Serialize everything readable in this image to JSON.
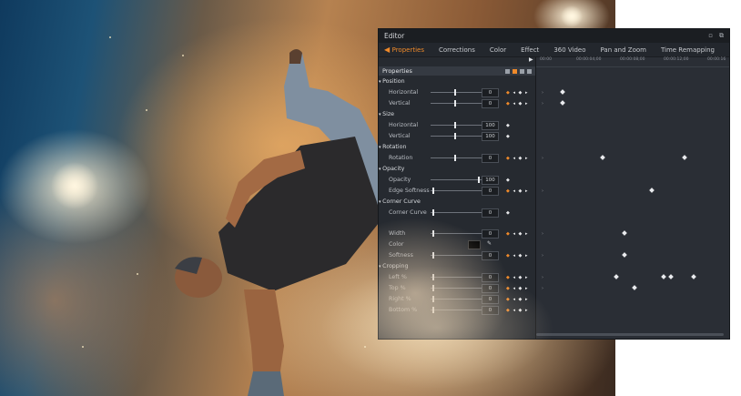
{
  "editor": {
    "title": "Editor",
    "window_icons": [
      "restore-icon",
      "copy-icon"
    ],
    "tabs": [
      {
        "label": "Properties",
        "active": true
      },
      {
        "label": "Corrections",
        "active": false
      },
      {
        "label": "Color",
        "active": false
      },
      {
        "label": "Effect",
        "active": false
      },
      {
        "label": "360 Video",
        "active": false
      },
      {
        "label": "Pan and Zoom",
        "active": false
      },
      {
        "label": "Time Remapping",
        "active": false
      }
    ],
    "ruler": [
      "00:00",
      "00:00:04;00",
      "00:00:08;00",
      "00:00:12;00",
      "00:00:16"
    ],
    "properties_header": "Properties",
    "accent": "#f08a2a",
    "rows": {
      "position": "Position",
      "pos_h": "Horizontal",
      "pos_h_val": "0",
      "pos_v": "Vertical",
      "pos_v_val": "0",
      "size": "Size",
      "size_h": "Horizontal",
      "size_h_val": "100",
      "size_v": "Vertical",
      "size_v_val": "100",
      "rotation_group": "Rotation",
      "rotation": "Rotation",
      "rotation_val": "0",
      "opacity_group": "Opacity",
      "opacity": "Opacity",
      "opacity_val": "100",
      "edge": "Edge Softness",
      "edge_val": "0",
      "corner_group": "Corner Curve",
      "corner": "Corner Curve",
      "corner_val": "0",
      "width": "Width",
      "width_val": "0",
      "color": "Color",
      "softness": "Softness",
      "softness_val": "0",
      "cropping": "Cropping",
      "left": "Left %",
      "left_val": "0",
      "top": "Top %",
      "top_val": "0",
      "right": "Right %",
      "right_val": "0",
      "bottom": "Bottom %",
      "bottom_val": "0"
    }
  }
}
